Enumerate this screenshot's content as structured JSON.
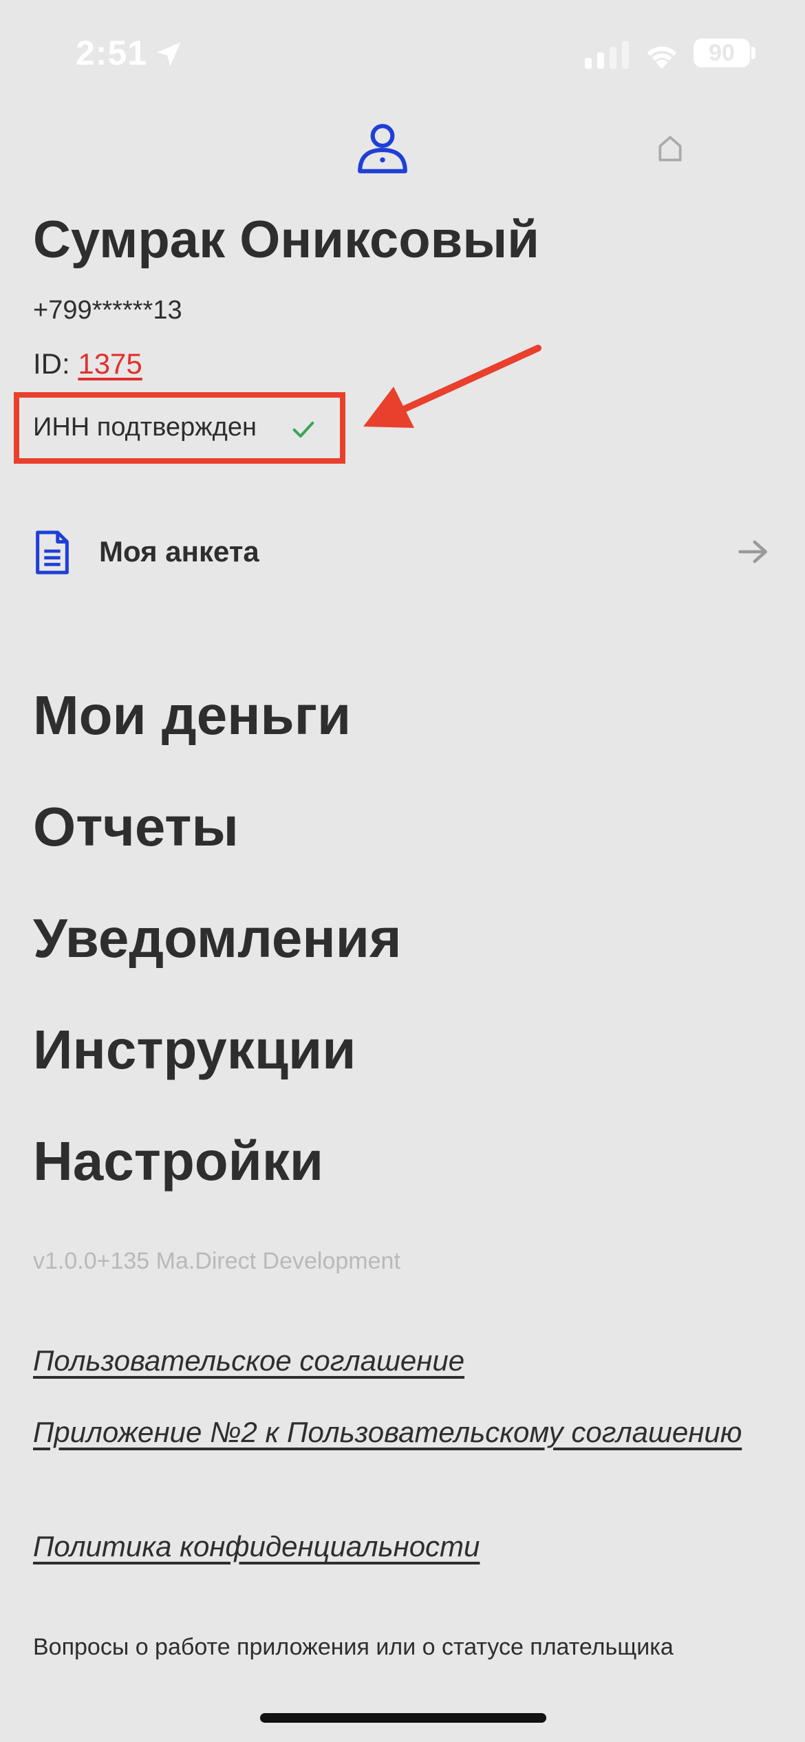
{
  "status_bar": {
    "time": "2:51",
    "battery": "90",
    "icons": [
      "location-arrow-icon",
      "signal-icon",
      "wifi-icon",
      "battery-icon"
    ]
  },
  "nav": {
    "icons": [
      "profile-icon",
      "home-icon"
    ],
    "active_color": "#1f3fd6",
    "inactive_color": "#aaaaaa"
  },
  "profile": {
    "name": "Сумрак Ониксовый",
    "phone": "+799******13",
    "id_label": "ID: ",
    "id_value": "1375",
    "inn_status": "ИНН подтвержден"
  },
  "form_row": {
    "label": "Моя анкета"
  },
  "menu": {
    "items": [
      "Мои деньги",
      "Отчеты",
      "Уведомления",
      "Инструкции",
      "Настройки"
    ]
  },
  "version": "v1.0.0+135 Ma.Direct Development",
  "legal": {
    "terms": "Пользовательское соглашение",
    "appendix": "Приложение №2 к Пользовательскому соглашению",
    "privacy": "Политика конфиденциальности"
  },
  "support_text": "Вопросы о работе приложения или о статусе плательщика",
  "colors": {
    "background": "#e7e7e7",
    "text": "#2e2e2e",
    "accent_blue": "#1f3fd6",
    "id_red": "#e0312d",
    "annotation_red": "#e8402c",
    "check_green": "#3aa35a",
    "muted": "#b9b9b9"
  }
}
